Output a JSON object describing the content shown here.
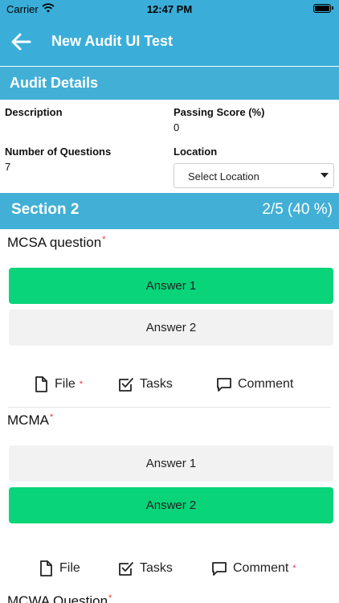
{
  "status_bar": {
    "carrier": "Carrier",
    "time": "12:47 PM"
  },
  "nav": {
    "title": "New Audit UI Test"
  },
  "audit_details": {
    "title": "Audit Details",
    "description_label": "Description",
    "passing_score_label": "Passing Score (%)",
    "passing_score_value": "0",
    "questions_label": "Number of Questions",
    "questions_value": "7",
    "location_label": "Location",
    "location_select": "Select Location"
  },
  "section": {
    "title": "Section 2",
    "progress": "2/5 (40 %)"
  },
  "required_mark": "*",
  "questions": [
    {
      "text": "MCSA question",
      "answers": [
        {
          "label": "Answer 1",
          "selected": true
        },
        {
          "label": "Answer 2",
          "selected": false
        }
      ],
      "actions": {
        "file": "File",
        "tasks": "Tasks",
        "comment": "Comment"
      }
    },
    {
      "text": "MCMA",
      "answers": [
        {
          "label": "Answer 1",
          "selected": false
        },
        {
          "label": "Answer 2",
          "selected": true
        }
      ],
      "actions": {
        "file": "File",
        "tasks": "Tasks",
        "comment": "Comment"
      }
    },
    {
      "text": "MCWA Question"
    }
  ],
  "colors": {
    "header": "#3aaed8",
    "selected_answer": "#09d479",
    "unselected_answer": "#f2f2f2",
    "required": "#e53935"
  }
}
